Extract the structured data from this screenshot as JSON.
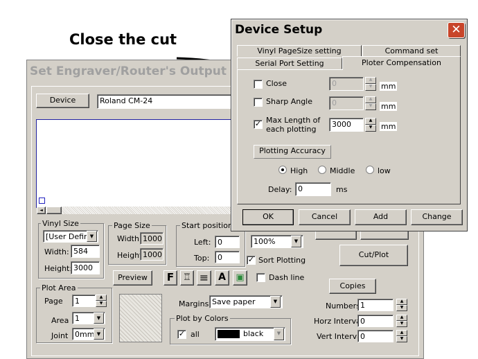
{
  "annotation": {
    "text": "Close the cut"
  },
  "engraver": {
    "title": "Set Engraver/Router's Output",
    "device_button": "Device",
    "device_value": "Roland CM-24",
    "vinyl_size": {
      "title": "Vinyl Size",
      "preset": "[User Defin",
      "width_label": "Width:",
      "width": "584",
      "height_label": "Height:",
      "height": "3000"
    },
    "page_size": {
      "title": "Page Size",
      "width_label": "Width",
      "width": "1000",
      "height_label": "Height",
      "height": "1000"
    },
    "start_position": {
      "title": "Start position",
      "left_label": "Left:",
      "left": "0",
      "top_label": "Top:",
      "top": "0"
    },
    "zoom": "100%",
    "sort_plotting": "Sort Plotting",
    "cut_plot": "Cut/Plot",
    "preview": "Preview",
    "tool_buttons": [
      "F",
      "♖",
      "≡",
      "A",
      "▣"
    ],
    "dash_line": "Dash line",
    "plot_area": {
      "title": "Plot Area",
      "page_label": "Page",
      "page": "1",
      "area_label": "Area",
      "area": "1",
      "joint_label": "Joint",
      "joint": "0mm"
    },
    "margins_label": "Margins",
    "margins_value": "Save paper",
    "plot_by_colors": {
      "title": "Plot by Colors",
      "all": "all",
      "color_name": "black",
      "color": "#000000"
    },
    "copies": {
      "title": "Copies",
      "numbers_label": "Numbers",
      "numbers": "1",
      "horz_label": "Horz Interval",
      "horz": "0",
      "vert_label": "Vert Interval",
      "vert": "0"
    }
  },
  "device_setup": {
    "title": "Device Setup",
    "close_icon": "close-icon",
    "tabs_back": [
      "Vinyl PageSize setting",
      "Command set"
    ],
    "tabs_front": [
      "Serial Port Setting",
      "Ploter Compensation"
    ],
    "active_tab": "Ploter Compensation",
    "close": {
      "label": "Close",
      "value": "0",
      "unit": "mm",
      "checked": false
    },
    "sharp_angle": {
      "label": "Sharp Angle",
      "value": "0",
      "unit": "mm",
      "checked": false
    },
    "max_length": {
      "label_1": "Max Length of",
      "label_2": "each plotting",
      "value": "3000",
      "unit": "mm",
      "checked": true
    },
    "plotting_accuracy": {
      "label": "Plotting Accuracy",
      "options": [
        "High",
        "Middle",
        "low"
      ],
      "selected": "High"
    },
    "delay": {
      "label": "Delay:",
      "value": "0",
      "unit": "ms"
    },
    "buttons": {
      "ok": "OK",
      "cancel": "Cancel",
      "add": "Add",
      "change": "Change"
    }
  }
}
